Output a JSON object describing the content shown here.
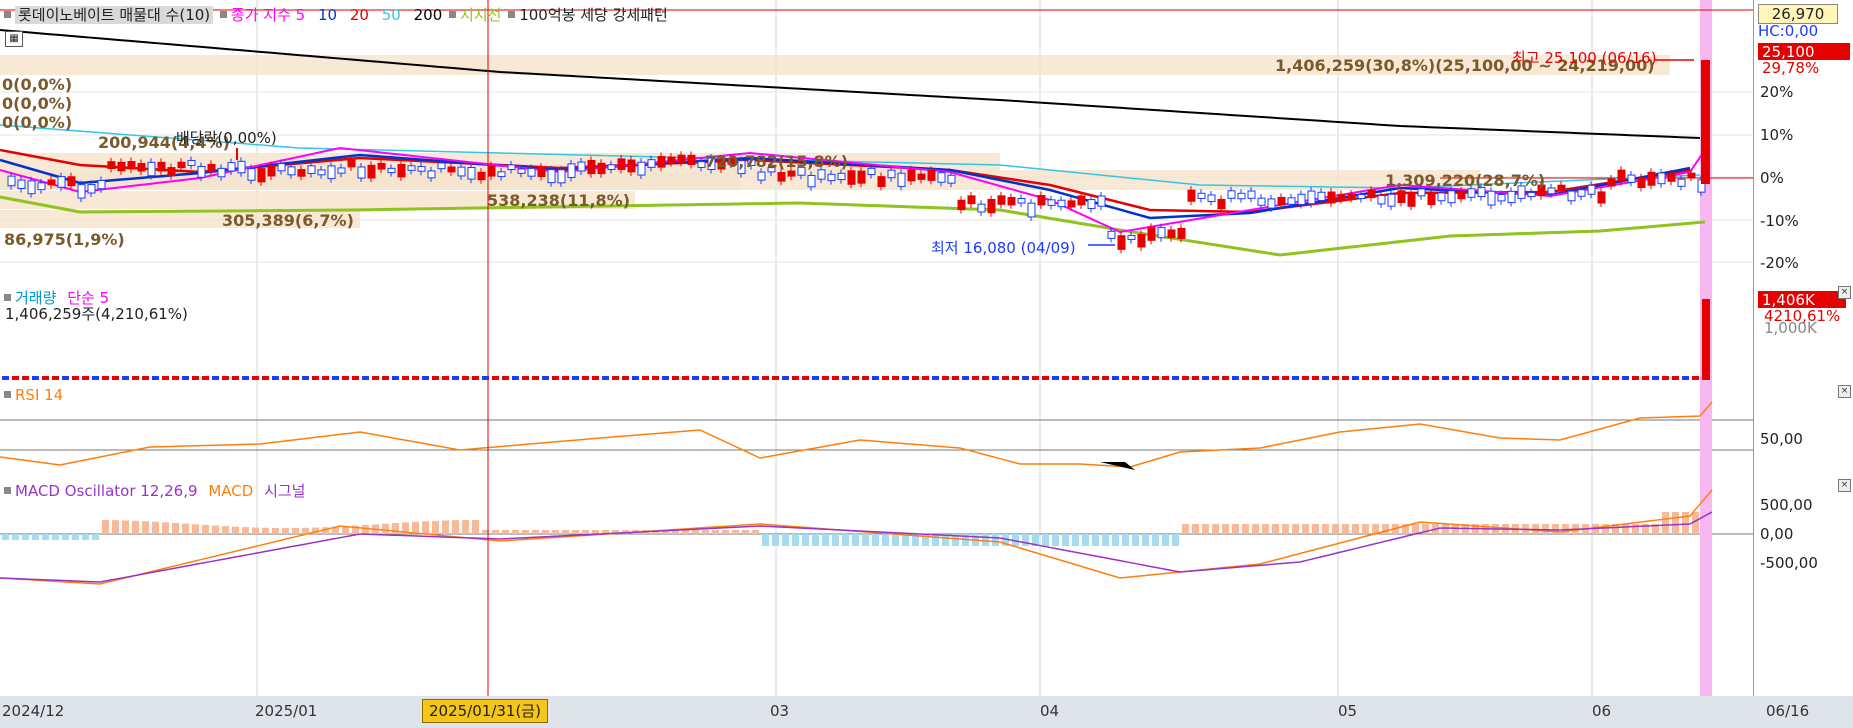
{
  "price_panel": {
    "legend": {
      "title": "롯데이노베이트 매물대 수(10)",
      "ma_label": "종가 지수 5",
      "ma10": "10",
      "ma20": "20",
      "ma50": "50",
      "ma200": "200",
      "trend": "지지선",
      "pattern": "100억봉 세당 강세패턴"
    },
    "left_pct": [
      "0(0,0%)",
      "0(0,0%)",
      "0(0,0%)"
    ],
    "volume_labels": [
      "1,406,259(30,8%)(25,100,00 ~ 24,219,00)",
      "200,944(4,4%)",
      "720,782(15,8%)",
      "538,238(11,8%)",
      "305,389(6,7%)",
      "86,975(1,9%)",
      "1,309,220(28,7%)"
    ],
    "dividend_label": "배당락(0,00%)",
    "high_label": "최고 25,100 (06/16)",
    "low_label": "최저 16,080 (04/09)",
    "axis": {
      "top_value": "26,970",
      "hc": "HC:0,00",
      "current_price": "25,100",
      "current_pct": "29,78%",
      "ticks": [
        "20%",
        "10%",
        "0%",
        "-10%",
        "-20%"
      ]
    }
  },
  "volume_panel": {
    "legend_name": "거래량",
    "legend_ma": "단순 5",
    "value": "1,406,259주(4,210,61%)",
    "axis_value": "1,406K",
    "axis_pct": "4210,61%",
    "axis_tick": "1,000K"
  },
  "rsi_panel": {
    "legend": "RSI 14",
    "axis_tick": "50,00"
  },
  "macd_panel": {
    "legend_osc": "MACD Oscillator 12,26,9",
    "legend_macd": "MACD",
    "legend_signal": "시그널",
    "ticks": [
      "500,00",
      "0,00",
      "-500,00"
    ]
  },
  "x_axis": {
    "labels": [
      "2024/12",
      "2025/01",
      "03",
      "04",
      "05",
      "06",
      "06/16"
    ],
    "cursor_date": "2025/01/31(금)"
  },
  "colors": {
    "up": "#e60000",
    "down": "#1a3cff",
    "ma5": "#ff00ff",
    "ma10": "#0033cc",
    "ma20": "#e60000",
    "ma50": "#33c6e6",
    "ma200": "#000000",
    "trend": "#8fc31f",
    "highlight": "#f7b8f2"
  }
}
